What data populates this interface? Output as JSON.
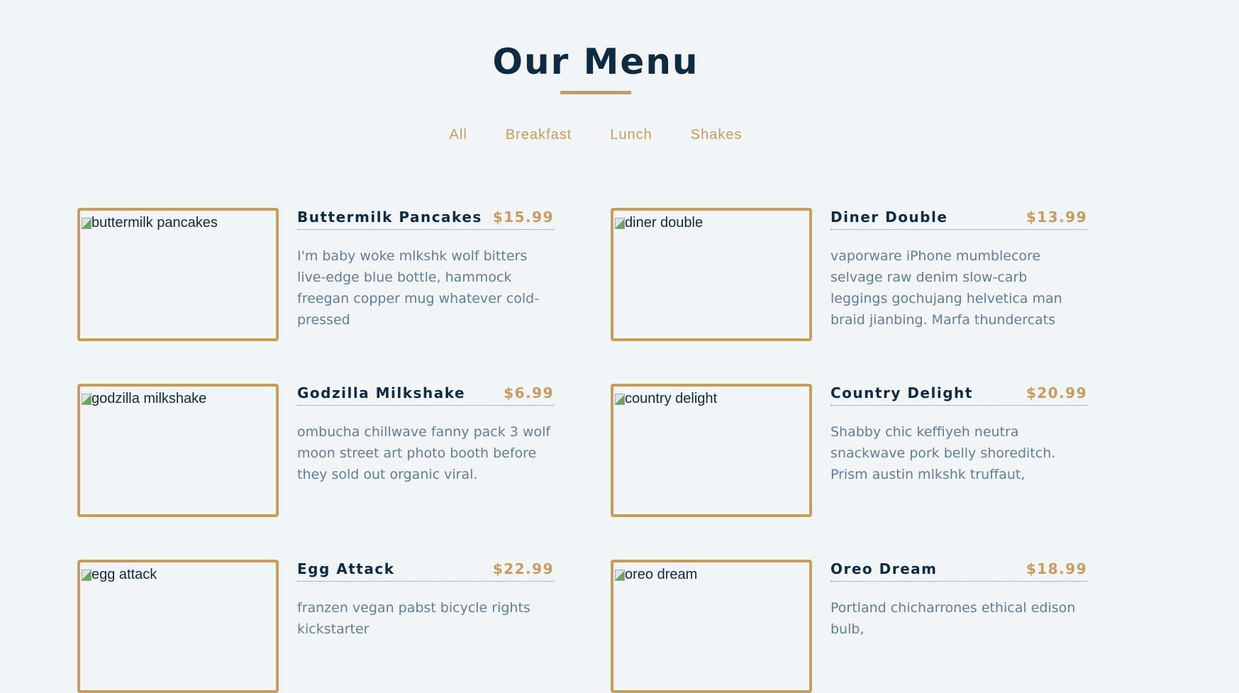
{
  "page": {
    "title": "Our Menu"
  },
  "colors": {
    "background": "#f1f5f8",
    "primary_dark": "#102a42",
    "accent_gold": "#c59d5f",
    "muted_text": "#617d98"
  },
  "filters": [
    "All",
    "Breakfast",
    "Lunch",
    "Shakes"
  ],
  "menu": {
    "items": [
      {
        "image_alt": "buttermilk pancakes",
        "name": "Buttermilk Pancakes",
        "price": "$15.99",
        "description": "I'm baby woke mlkshk wolf bitters live-edge blue bottle, hammock freegan copper mug whatever cold-pressed"
      },
      {
        "image_alt": "diner double",
        "name": "Diner Double",
        "price": "$13.99",
        "description": "vaporware iPhone mumblecore selvage raw denim slow-carb leggings gochujang helvetica man braid jianbing. Marfa thundercats"
      },
      {
        "image_alt": "godzilla milkshake",
        "name": "Godzilla Milkshake",
        "price": "$6.99",
        "description": "ombucha chillwave fanny pack 3 wolf moon street art photo booth before they sold out organic viral."
      },
      {
        "image_alt": "country delight",
        "name": "Country Delight",
        "price": "$20.99",
        "description": "Shabby chic keffiyeh neutra snackwave pork belly shoreditch. Prism austin mlkshk truffaut,"
      },
      {
        "image_alt": "egg attack",
        "name": "Egg Attack",
        "price": "$22.99",
        "description": "franzen vegan pabst bicycle rights kickstarter"
      },
      {
        "image_alt": "oreo dream",
        "name": "Oreo Dream",
        "price": "$18.99",
        "description": "Portland chicharrones ethical edison bulb,"
      }
    ]
  }
}
